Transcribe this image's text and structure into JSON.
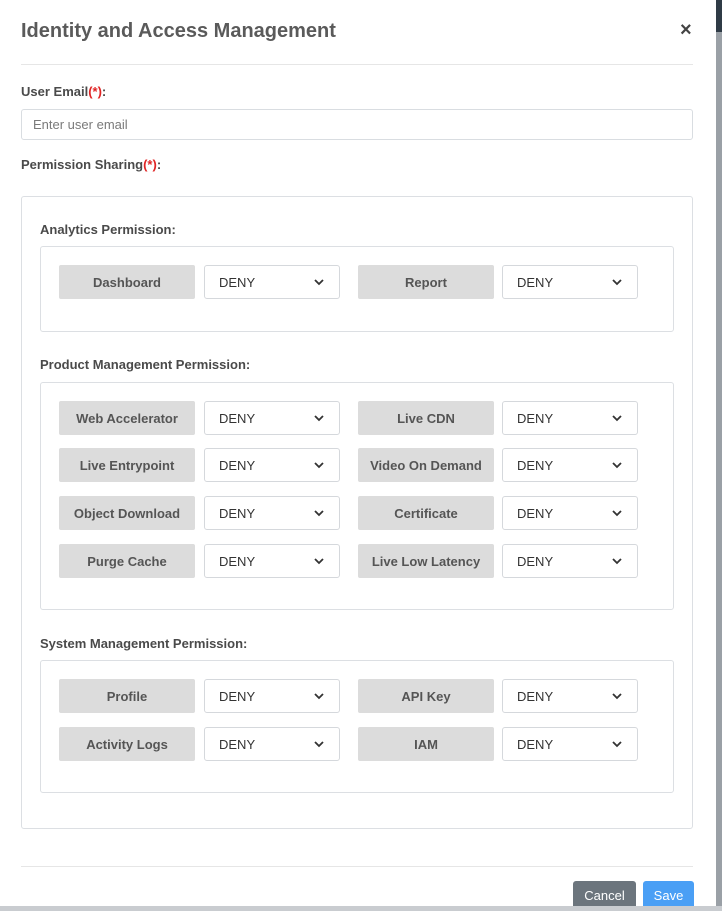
{
  "modal": {
    "title": "Identity and Access Management",
    "close_label": "×"
  },
  "email": {
    "label": "User Email",
    "required_mark": "(*)",
    "colon": ":",
    "placeholder": "Enter user email",
    "value": ""
  },
  "permission_sharing": {
    "label": "Permission Sharing",
    "required_mark": "(*)",
    "colon": ":"
  },
  "sections": {
    "analytics": {
      "title": "Analytics Permission:",
      "items": [
        {
          "label": "Dashboard",
          "value": "DENY"
        },
        {
          "label": "Report",
          "value": "DENY"
        }
      ]
    },
    "product": {
      "title": "Product Management Permission:",
      "items": [
        {
          "label": "Web Accelerator",
          "value": "DENY"
        },
        {
          "label": "Live CDN",
          "value": "DENY"
        },
        {
          "label": "Live Entrypoint",
          "value": "DENY"
        },
        {
          "label": "Video On Demand",
          "value": "DENY"
        },
        {
          "label": "Object Download",
          "value": "DENY"
        },
        {
          "label": "Certificate",
          "value": "DENY"
        },
        {
          "label": "Purge Cache",
          "value": "DENY"
        },
        {
          "label": "Live Low Latency",
          "value": "DENY"
        }
      ]
    },
    "system": {
      "title": "System Management Permission:",
      "items": [
        {
          "label": "Profile",
          "value": "DENY"
        },
        {
          "label": "API Key",
          "value": "DENY"
        },
        {
          "label": "Activity Logs",
          "value": "DENY"
        },
        {
          "label": "IAM",
          "value": "DENY"
        }
      ]
    }
  },
  "footer": {
    "cancel_label": "Cancel",
    "save_label": "Save"
  },
  "colors": {
    "required": "#e02424",
    "cancel_button": "#6c757d",
    "save_button": "#4a9ff5",
    "permission_label_bg": "#dcdcdc"
  },
  "icons": {
    "close": "close-icon",
    "select_arrow": "chevron-down-icon"
  }
}
